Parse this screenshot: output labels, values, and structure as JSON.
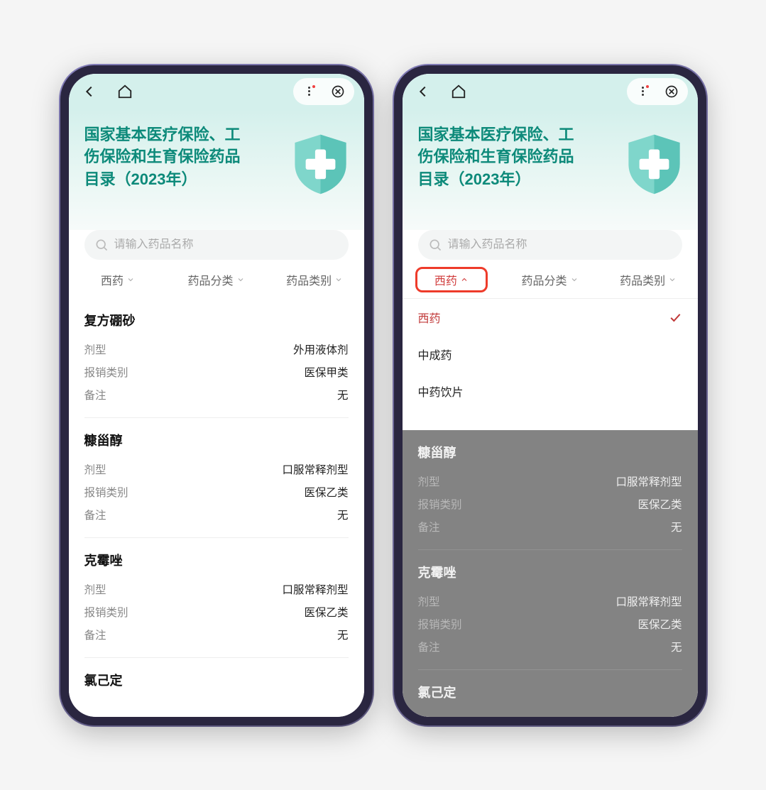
{
  "header": {
    "title_l1": "国家基本医疗保险、工",
    "title_l2": "伤保险和生育保险药品",
    "title_l3": "目录（2023年）"
  },
  "search": {
    "placeholder": "请输入药品名称"
  },
  "filters": {
    "f1": "西药",
    "f2": "药品分类",
    "f3": "药品类别"
  },
  "dropdown": {
    "opt1": "西药",
    "opt2": "中成药",
    "opt3": "中药饮片"
  },
  "labels": {
    "dosage": "剂型",
    "reimburse": "报销类别",
    "remark": "备注"
  },
  "drugs": [
    {
      "name": "复方硼砂",
      "dosage": "外用液体剂",
      "reimburse": "医保甲类",
      "remark": "无"
    },
    {
      "name": "糠甾醇",
      "dosage": "口服常释剂型",
      "reimburse": "医保乙类",
      "remark": "无"
    },
    {
      "name": "克霉唑",
      "dosage": "口服常释剂型",
      "reimburse": "医保乙类",
      "remark": "无"
    },
    {
      "name": "氯己定",
      "dosage": "",
      "reimburse": "",
      "remark": ""
    }
  ],
  "drugs_right": [
    {
      "name": "糠甾醇",
      "dosage": "口服常释剂型",
      "reimburse": "医保乙类",
      "remark": "无"
    },
    {
      "name": "克霉唑",
      "dosage": "口服常释剂型",
      "reimburse": "医保乙类",
      "remark": "无"
    },
    {
      "name": "氯己定",
      "dosage": "",
      "reimburse": "",
      "remark": ""
    }
  ]
}
